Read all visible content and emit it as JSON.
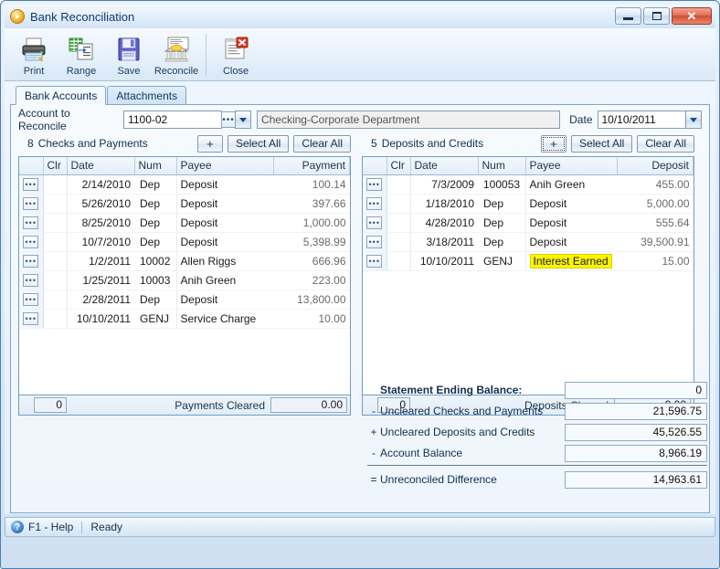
{
  "window": {
    "title": "Bank Reconciliation",
    "title_icon": "play-circle-icon",
    "buttons": {
      "minimize": "minimize-icon",
      "maximize": "maximize-icon",
      "close": "✕"
    }
  },
  "toolbar": {
    "items": [
      {
        "label": "Print",
        "icon": "printer-icon"
      },
      {
        "label": "Range",
        "icon": "range-icon"
      },
      {
        "label": "Save",
        "icon": "floppy-disk-icon"
      },
      {
        "label": "Reconcile",
        "icon": "bank-icon"
      },
      {
        "label": "Close",
        "icon": "close-document-icon"
      }
    ]
  },
  "tabs": [
    {
      "label": "Bank Accounts",
      "active": true
    },
    {
      "label": "Attachments",
      "active": false
    }
  ],
  "account_row": {
    "label": "Account to Reconcile",
    "account_value": "1100-02",
    "account_description": "Checking-Corporate Department",
    "date_label": "Date",
    "date_value": "10/10/2011"
  },
  "left_panel": {
    "count": "8",
    "title": "Checks and Payments",
    "add_label": "+",
    "select_all_label": "Select All",
    "clear_all_label": "Clear All",
    "columns": [
      "",
      "Clr",
      "Date",
      "Num",
      "Payee",
      "Payment"
    ],
    "rows": [
      {
        "date": "2/14/2010",
        "num": "Dep",
        "payee": "Deposit",
        "amount": "100.14"
      },
      {
        "date": "5/26/2010",
        "num": "Dep",
        "payee": "Deposit",
        "amount": "397.66"
      },
      {
        "date": "8/25/2010",
        "num": "Dep",
        "payee": "Deposit",
        "amount": "1,000.00"
      },
      {
        "date": "10/7/2010",
        "num": "Dep",
        "payee": "Deposit",
        "amount": "5,398.99"
      },
      {
        "date": "1/2/2011",
        "num": "10002",
        "payee": "Allen Riggs",
        "amount": "666.96"
      },
      {
        "date": "1/25/2011",
        "num": "10003",
        "payee": "Anih Green",
        "amount": "223.00"
      },
      {
        "date": "2/28/2011",
        "num": "Dep",
        "payee": "Deposit",
        "amount": "13,800.00"
      },
      {
        "date": "10/10/2011",
        "num": "GENJ",
        "payee": "Service Charge",
        "amount": "10.00"
      }
    ],
    "cleared_count": "0",
    "cleared_label": "Payments Cleared",
    "cleared_value": "0.00"
  },
  "right_panel": {
    "count": "5",
    "title": "Deposits and Credits",
    "add_label": "+",
    "select_all_label": "Select All",
    "clear_all_label": "Clear All",
    "columns": [
      "",
      "Clr",
      "Date",
      "Num",
      "Payee",
      "Deposit"
    ],
    "rows": [
      {
        "date": "7/3/2009",
        "num": "100053",
        "payee": "Anih Green",
        "amount": "455.00",
        "highlight": false
      },
      {
        "date": "1/18/2010",
        "num": "Dep",
        "payee": "Deposit",
        "amount": "5,000.00",
        "highlight": false
      },
      {
        "date": "4/28/2010",
        "num": "Dep",
        "payee": "Deposit",
        "amount": "555.64",
        "highlight": false
      },
      {
        "date": "3/18/2011",
        "num": "Dep",
        "payee": "Deposit",
        "amount": "39,500.91",
        "highlight": false
      },
      {
        "date": "10/10/2011",
        "num": "GENJ",
        "payee": "Interest Earned",
        "amount": "15.00",
        "highlight": true
      }
    ],
    "cleared_count": "0",
    "cleared_label": "Deposits Cleared",
    "cleared_value": "0.00"
  },
  "summary": {
    "rows": [
      {
        "op": "",
        "label": "Statement Ending Balance:",
        "value": "0",
        "bold": true
      },
      {
        "op": "-",
        "label": "Uncleared Checks and Payments",
        "value": "21,596.75",
        "bold": false
      },
      {
        "op": "+",
        "label": "Uncleared Deposits and Credits",
        "value": "45,526.55",
        "bold": false
      },
      {
        "op": "-",
        "label": "Account Balance",
        "value": "8,966.19",
        "bold": false
      }
    ],
    "total": {
      "op": "=",
      "label": "Unreconciled Difference",
      "value": "14,963.61"
    }
  },
  "statusbar": {
    "help_icon": "question-circle-icon",
    "help_label": "F1 - Help",
    "status": "Ready"
  },
  "colors": {
    "highlight_yellow": "#fcf500",
    "window_border": "#4a7fb5",
    "title_text": "#13386b"
  }
}
